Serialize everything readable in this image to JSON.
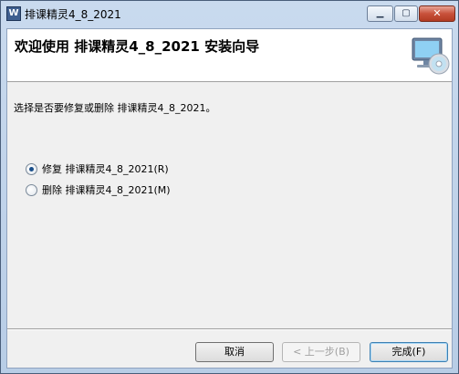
{
  "window": {
    "title": "排课精灵4_8_2021",
    "app_icon_glyph": "W",
    "controls": {
      "minimize": "▁",
      "maximize": "▢",
      "close": "✕"
    }
  },
  "banner": {
    "title": "欢迎使用 排课精灵4_8_2021 安装向导",
    "art_icon": "computer-disc-icon"
  },
  "main": {
    "prompt": "选择是否要修复或删除 排课精灵4_8_2021。",
    "options": [
      {
        "label": "修复 排课精灵4_8_2021(R)",
        "checked": true
      },
      {
        "label": "删除 排课精灵4_8_2021(M)",
        "checked": false
      }
    ]
  },
  "buttons": {
    "cancel": "取消",
    "back": "< 上一步(B)",
    "finish": "完成(F)"
  },
  "colors": {
    "titlebar": "#c9daee",
    "close_button": "#c8513a",
    "client_bg": "#f0f0f0"
  }
}
